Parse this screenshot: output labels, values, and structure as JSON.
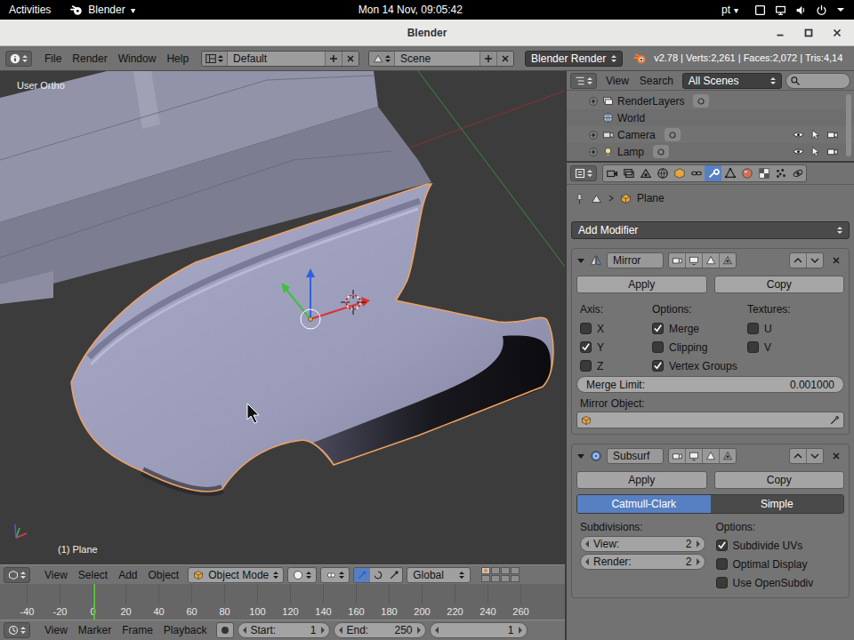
{
  "topbar": {
    "activities": "Activities",
    "app": "Blender",
    "app_arrow": "▾",
    "clock": "Mon 14 Nov, 09:05:42",
    "language": "pt",
    "language_arrow": "▾"
  },
  "window": {
    "title": "Blender"
  },
  "info_header": {
    "menus": [
      "File",
      "Render",
      "Window",
      "Help"
    ],
    "layout": "Default",
    "scene": "Scene",
    "engine": "Blender Render",
    "stats": "v2.78 | Verts:2,261 | Faces:2,072 | Tris:4,14"
  },
  "viewport": {
    "view_name": "User Ortho",
    "object_label": "(1) Plane"
  },
  "view3d_header": {
    "menus": [
      "View",
      "Select",
      "Add",
      "Object"
    ],
    "mode": "Object Mode",
    "orientation": "Global",
    "manipulators": [
      {
        "selected": true
      },
      {
        "selected": false
      },
      {
        "selected": false
      }
    ],
    "layers": [
      {
        "active": true
      },
      {
        "active": false
      },
      {
        "active": false
      },
      {
        "active": false
      },
      {
        "active": false
      },
      {
        "active": false
      },
      {
        "active": false
      },
      {
        "active": false
      }
    ]
  },
  "timeline": {
    "ticks": [
      {
        "label": "-40",
        "cursor": false
      },
      {
        "label": "-20",
        "cursor": false
      },
      {
        "label": "0",
        "cursor": true
      },
      {
        "label": "20",
        "cursor": false
      },
      {
        "label": "40",
        "cursor": false
      },
      {
        "label": "60",
        "cursor": false
      },
      {
        "label": "80",
        "cursor": false
      },
      {
        "label": "100",
        "cursor": false
      },
      {
        "label": "120",
        "cursor": false
      },
      {
        "label": "140",
        "cursor": false
      },
      {
        "label": "160",
        "cursor": false
      },
      {
        "label": "180",
        "cursor": false
      },
      {
        "label": "200",
        "cursor": false
      },
      {
        "label": "220",
        "cursor": false
      },
      {
        "label": "240",
        "cursor": false
      },
      {
        "label": "260",
        "cursor": false
      }
    ]
  },
  "timeline_header": {
    "menus": [
      "View",
      "Marker",
      "Frame",
      "Playback"
    ],
    "start_label": "Start:",
    "start": "1",
    "end_label": "End:",
    "end": "250",
    "frame": "1"
  },
  "outliner": {
    "menus": [
      "View",
      "Search"
    ],
    "filter": "All Scenes",
    "rows": [
      {
        "label": "RenderLayers",
        "expandable": true,
        "expanded": false,
        "has_data_icon": true,
        "restrict_icons": false
      },
      {
        "label": "World",
        "expandable": false,
        "expanded": false,
        "has_data_icon": false,
        "restrict_icons": false
      },
      {
        "label": "Camera",
        "expandable": true,
        "expanded": false,
        "has_data_icon": true,
        "restrict_icons": true
      },
      {
        "label": "Lamp",
        "expandable": true,
        "expanded": false,
        "has_data_icon": true,
        "restrict_icons": true
      }
    ]
  },
  "properties": {
    "tabs": [
      {
        "selected": false
      },
      {
        "selected": false
      },
      {
        "selected": false
      },
      {
        "selected": false
      },
      {
        "selected": false
      },
      {
        "selected": false
      },
      {
        "selected": true
      },
      {
        "selected": false
      },
      {
        "selected": false
      },
      {
        "selected": false
      },
      {
        "selected": false
      },
      {
        "selected": false
      }
    ],
    "breadcrumb": "Plane",
    "add_modifier": "Add Modifier",
    "modifiers": [
      {
        "kind": "mirror",
        "name": "Mirror",
        "expanded": true,
        "apply": "Apply",
        "copy": "Copy",
        "columns": [
          {
            "title": "Axis:",
            "items": [
              {
                "label": "X",
                "checked": false
              },
              {
                "label": "Y",
                "checked": true
              },
              {
                "label": "Z",
                "checked": false
              }
            ]
          },
          {
            "title": "Options:",
            "items": [
              {
                "label": "Merge",
                "checked": true
              },
              {
                "label": "Clipping",
                "checked": false
              },
              {
                "label": "Vertex Groups",
                "checked": true
              }
            ]
          },
          {
            "title": "Textures:",
            "items": [
              {
                "label": "U",
                "checked": false
              },
              {
                "label": "V",
                "checked": false
              }
            ]
          }
        ],
        "merge_limit": {
          "label": "Merge Limit:",
          "value": "0.001000"
        },
        "mirror_object": {
          "label": "Mirror Object:"
        }
      },
      {
        "kind": "subsurf",
        "name": "Subsurf",
        "expanded": true,
        "apply": "Apply",
        "copy": "Copy",
        "types": [
          {
            "label": "Catmull-Clark",
            "selected": true
          },
          {
            "label": "Simple",
            "selected": false
          }
        ],
        "subdivisions": {
          "title": "Subdivisions:",
          "fields": [
            {
              "label": "View:",
              "value": "2"
            },
            {
              "label": "Render:",
              "value": "2"
            }
          ]
        },
        "options": {
          "title": "Options:",
          "items": [
            {
              "label": "Subdivide UVs",
              "checked": true
            },
            {
              "label": "Optimal Display",
              "checked": false
            },
            {
              "label": "Use OpenSubdiv",
              "checked": false
            }
          ]
        }
      }
    ]
  }
}
